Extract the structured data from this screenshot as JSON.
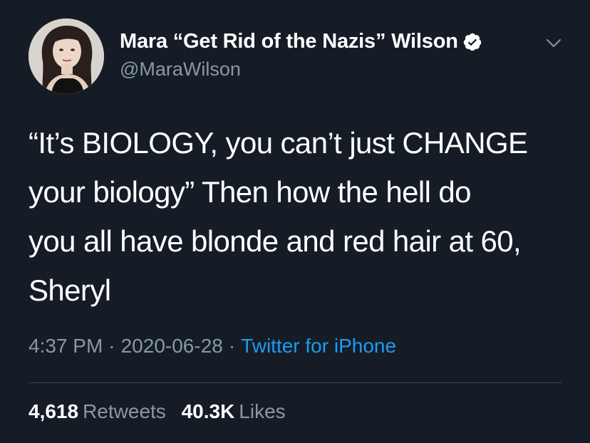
{
  "tweet": {
    "author": {
      "display_name": "Mara “Get Rid of the Nazis” Wilson",
      "handle": "@MaraWilson",
      "verified": true
    },
    "text": "“It’s BIOLOGY, you can’t just CHANGE\nyour biology” Then how the hell do\nyou all have blonde and red hair at 60,\nSheryl",
    "time": "4:37 PM",
    "date": "2020-06-28",
    "source": "Twitter for iPhone",
    "separator": "·",
    "retweets": {
      "count": "4,618",
      "label": "Retweets"
    },
    "likes": {
      "count": "40.3K",
      "label": "Likes"
    }
  },
  "colors": {
    "background": "#151c26",
    "text": "#ffffff",
    "secondary": "#8899a6",
    "link": "#1d9bf0",
    "divider": "#38444d"
  },
  "icons": {
    "verified": "verified-badge-icon",
    "chevron": "chevron-down-icon"
  }
}
